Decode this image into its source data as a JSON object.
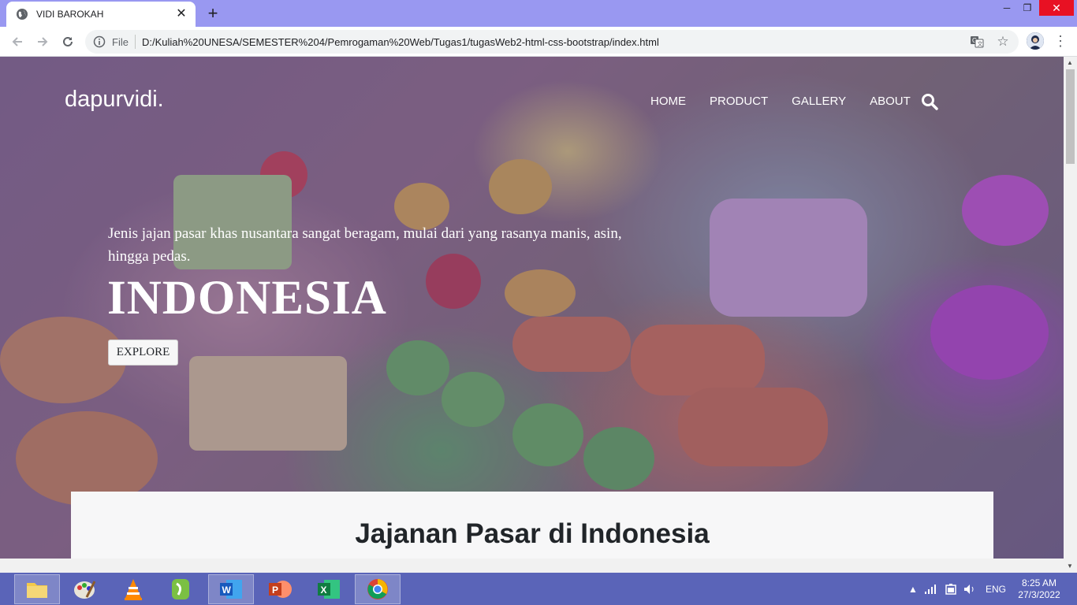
{
  "browser": {
    "tab_title": "VIDI BAROKAH",
    "omnibox_scheme_label": "File",
    "url": "D:/Kuliah%20UNESA/SEMESTER%204/Pemrogaman%20Web/Tugas1/tugasWeb2-html-css-bootstrap/index.html"
  },
  "site": {
    "brand": "dapurvidi.",
    "nav": [
      "HOME",
      "PRODUCT",
      "GALLERY",
      "ABOUT"
    ],
    "hero": {
      "subtitle": "Jenis jajan pasar khas nusantara sangat beragam, mulai dari yang rasanya manis, asin, hingga pedas.",
      "title": "INDONESIA",
      "button_label": "EXPLORE"
    },
    "section_title": "Jajanan Pasar di Indonesia"
  },
  "taskbar": {
    "apps": [
      "file-explorer",
      "paint",
      "vlc",
      "camtasia",
      "word",
      "powerpoint",
      "excel",
      "chrome"
    ],
    "language": "ENG",
    "time": "8:25 AM",
    "date": "27/3/2022"
  }
}
